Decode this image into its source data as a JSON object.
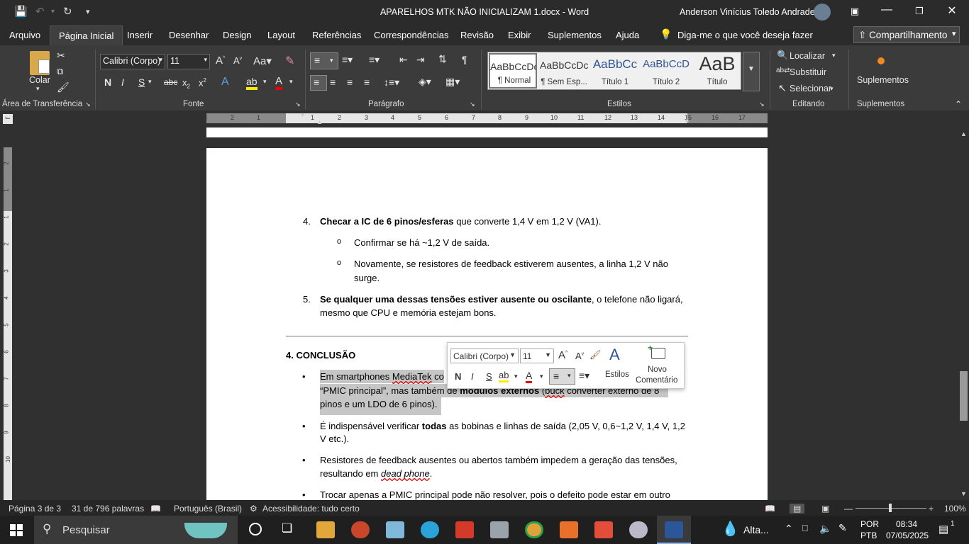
{
  "window": {
    "doc_title": "APARELHOS MTK NÃO INICIALIZAM 1.docx  -  Word",
    "user": "Anderson Vinícius Toledo Andrade"
  },
  "menu": {
    "items": [
      "Arquivo",
      "Página Inicial",
      "Inserir",
      "Desenhar",
      "Design",
      "Layout",
      "Referências",
      "Correspondências",
      "Revisão",
      "Exibir",
      "Suplementos",
      "Ajuda"
    ],
    "tell_me": "Diga-me o que você deseja fazer",
    "share": "Compartilhamento"
  },
  "ribbon": {
    "clipboard": {
      "paste": "Colar",
      "group": "Área de Transferência"
    },
    "font": {
      "name": "Calibri (Corpo)",
      "size": "11",
      "group": "Fonte"
    },
    "paragraph": {
      "group": "Parágrafo"
    },
    "styles": {
      "group": "Estilos",
      "items": [
        {
          "sample": "AaBbCcDc",
          "name": "¶ Normal"
        },
        {
          "sample": "AaBbCcDc",
          "name": "¶ Sem Esp..."
        },
        {
          "sample": "AaBbCc",
          "name": "Título 1"
        },
        {
          "sample": "AaBbCcD",
          "name": "Título 2"
        },
        {
          "sample": "AaB",
          "name": "Título"
        }
      ]
    },
    "editing": {
      "find": "Localizar",
      "replace": "Substituir",
      "select": "Selecionar",
      "group": "Editando"
    },
    "addins": {
      "label": "Suplementos",
      "group": "Suplementos"
    }
  },
  "ruler": {
    "numbers": [
      "3",
      "2",
      "1",
      "1",
      "2",
      "3",
      "4",
      "5",
      "6",
      "7",
      "8",
      "9",
      "10",
      "11",
      "12",
      "13",
      "14",
      "15",
      "16",
      "17"
    ],
    "vnumbers": [
      "2",
      "1",
      "1",
      "2",
      "3",
      "4",
      "5",
      "6",
      "7",
      "8",
      "9",
      "10"
    ]
  },
  "document": {
    "item4": {
      "num": "4.",
      "bold": "Checar a IC de 6 pinos/esferas",
      "rest": " que converte 1,4 V em 1,2 V (VA1)."
    },
    "sub1": "Confirmar se há ~1,2 V de saída.",
    "sub2_a": "Novamente, se resistores de feedback estiverem ausentes, a linha 1,2 V não",
    "sub2_b": "surge.",
    "item5": {
      "num": "5.",
      "bold": "Se qualquer uma dessas tensões estiver ausente ou oscilante",
      "rest": ", o telefone não ligará,",
      "line2": "mesmo que CPU e memória estejam bons."
    },
    "heading": "4. CONCLUSÃO",
    "b1_a": "Em smartphones ",
    "b1_mt": "MediaTek",
    "b1_co": " co",
    "b1_l2a": "“PMIC principal”, mas também de ",
    "b1_l2b": "módulos externos",
    "b1_l2c": " (",
    "b1_buck": "buck",
    "b1_l2d": " converter externo de 8",
    "b1_l3": "pinos e um LDO de 6 pinos).",
    "b2_a": "É indispensável verificar ",
    "b2_b": "todas",
    "b2_c": " as bobinas e linhas de saída (2,05 V, 0,6~1,2 V, 1,4 V, 1,2",
    "b2_l2": "V etc.).",
    "b3_l1": "Resistores de feedback ausentes ou abertos também impedem a geração das tensões,",
    "b3_l2a": "resultando em ",
    "b3_l2b": "dead phone",
    "b3_l2c": ".",
    "b4_l1": "Trocar apenas a PMIC principal pode não resolver, pois o defeito pode estar em outro"
  },
  "minitoolbar": {
    "font": "Calibri (Corpo)",
    "size": "11",
    "bold": "N",
    "italic": "I",
    "underline": "S",
    "styles": "Estilos",
    "comment_a": "Novo",
    "comment_b": "Comentário"
  },
  "status": {
    "page": "Página 3 de 3",
    "words": "31 de 796 palavras",
    "lang": "Português (Brasil)",
    "accessibility": "Acessibilidade: tudo certo",
    "zoom": "100%"
  },
  "taskbar": {
    "search": "Pesquisar",
    "weather": "Alta...",
    "lang1": "POR",
    "lang2": "PTB",
    "time": "08:34",
    "date": "07/05/2025",
    "notif": "1"
  },
  "colors": {
    "accent_word": "#2b579a",
    "selection": "#c6c6c6"
  }
}
